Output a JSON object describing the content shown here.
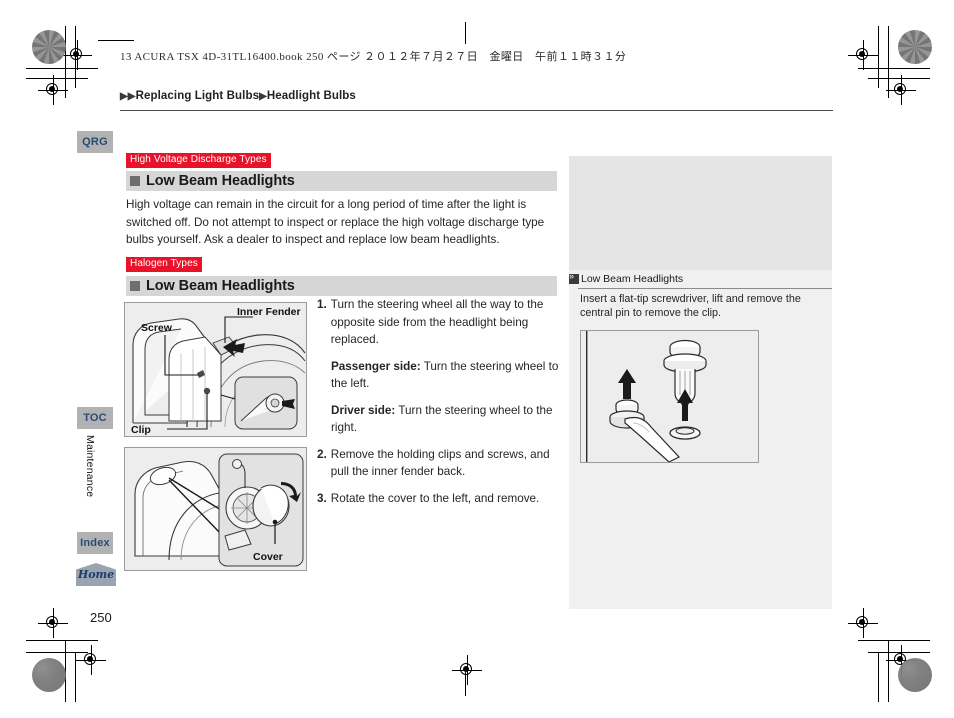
{
  "print_header": {
    "text": "13 ACURA TSX 4D-31TL16400.book  250 ページ  ２０１２年７月２７日　金曜日　午前１１時３１分"
  },
  "breadcrumb": {
    "arrow": "▶",
    "item1": "Replacing Light Bulbs",
    "item2": "Headlight Bulbs"
  },
  "side_tabs": {
    "qrg": "QRG",
    "toc": "TOC",
    "chapter": "Maintenance",
    "index": "Index",
    "home": "Home"
  },
  "sections": [
    {
      "tag": "High Voltage Discharge Types",
      "heading": "Low Beam Headlights",
      "body": "High voltage can remain in the circuit for a long period of time after the light is switched off. Do not attempt to inspect or replace the high voltage discharge type bulbs yourself. Ask a dealer to inspect and replace low beam headlights."
    },
    {
      "tag": "Halogen Types",
      "heading": "Low Beam Headlights"
    }
  ],
  "steps": [
    {
      "num": "1.",
      "text": "Turn the steering wheel all the way to the opposite side from the headlight being replaced."
    },
    {
      "num": "2.",
      "text": "Remove the holding clips and screws, and pull the inner fender back."
    },
    {
      "num": "3.",
      "text": "Rotate the cover to the left, and remove."
    }
  ],
  "sub_paragraphs": [
    {
      "label": "Passenger side:",
      "text": " Turn the steering wheel to the left."
    },
    {
      "label": "Driver side:",
      "text": " Turn the steering wheel to the right."
    }
  ],
  "side_panel": {
    "heading": "Low Beam Headlights",
    "text": "Insert a flat-tip screwdriver, lift and remove the central pin to remove the clip."
  },
  "figures": {
    "fender": {
      "labels": [
        "Inner Fender",
        "Screw",
        "Clip"
      ]
    },
    "cover": {
      "labels": [
        "Cover"
      ]
    }
  },
  "page_number": "250",
  "colors": {
    "red_tag": "#e8132b",
    "heading_bar": "#d6d6d6",
    "tab": "#b2b2b2",
    "tab_text": "#2c4a77",
    "panel": "#f0f0f0"
  }
}
